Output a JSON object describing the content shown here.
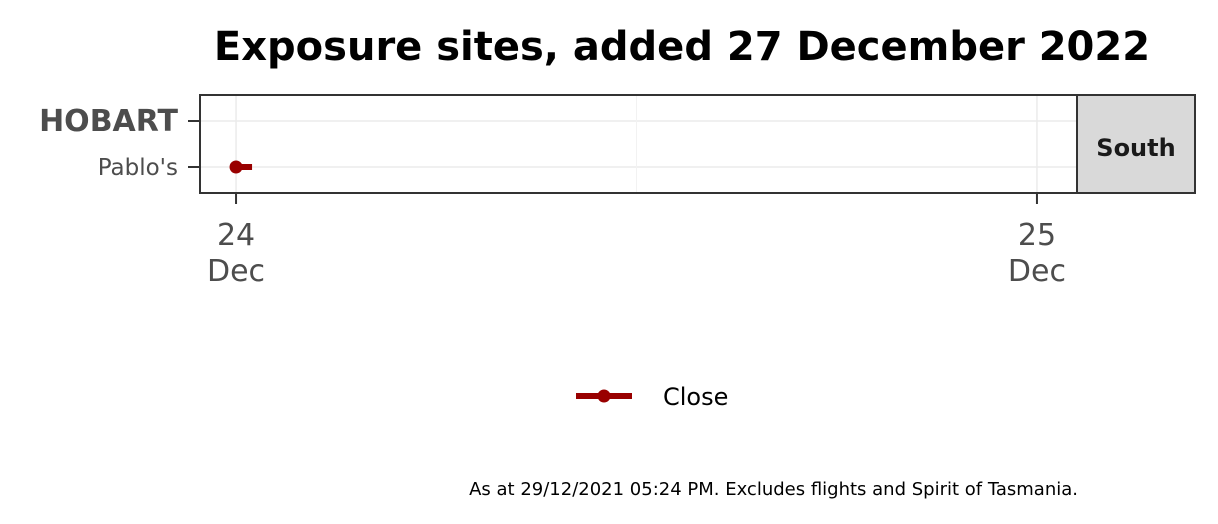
{
  "chart_data": {
    "type": "line",
    "title": "Exposure sites, added 27 December 2022",
    "facet_label": "South",
    "y_categories": [
      "HOBART",
      "Pablo's"
    ],
    "x_ticks": [
      {
        "day": "24",
        "month": "Dec",
        "value": 24.0
      },
      {
        "day": "25",
        "month": "Dec",
        "value": 25.0
      }
    ],
    "xlim": [
      23.955,
      25.05
    ],
    "grid": true,
    "legend_position": "bottom",
    "series": [
      {
        "name": "Close",
        "color": "#990000",
        "segments": [
          {
            "category": "Pablo's",
            "start": 24.0,
            "end": 24.02
          }
        ]
      }
    ],
    "caption": "As at 29/12/2021 05:24 PM. Excludes flights and Spirit of Tasmania."
  }
}
